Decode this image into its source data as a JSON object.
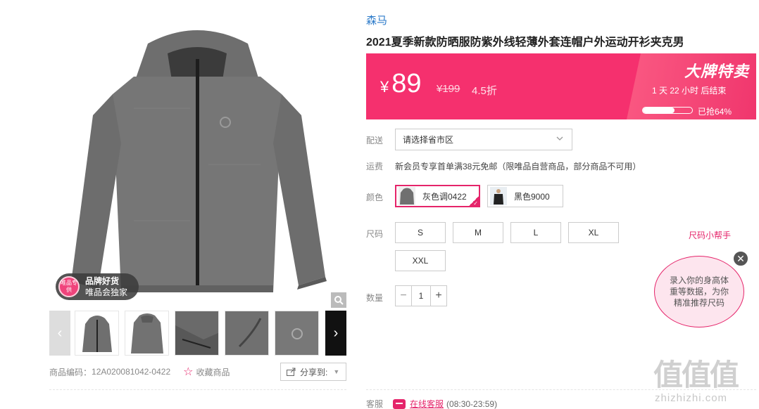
{
  "product": {
    "brand": "森马",
    "title": "2021夏季新款防晒服防紫外线轻薄外套连帽户外运动开衫夹克男"
  },
  "gallery": {
    "badge_icon_text": "唯品专供",
    "badge_line1": "品牌好货",
    "badge_line2": "唯品会独家",
    "prev": "‹",
    "next": "›"
  },
  "price": {
    "currency": "¥",
    "current": "89",
    "original": "¥199",
    "discount": "4.5折",
    "sale_title": "大牌特卖",
    "countdown": "1 天 22 小时 后结束",
    "sold_text": "已抢64%",
    "sold_fraction": 0.64
  },
  "delivery": {
    "label": "配送",
    "placeholder": "请选择省市区"
  },
  "shipping": {
    "label": "运费",
    "text": "新会员专享首单满38元免邮（限唯品自营商品，部分商品不可用）"
  },
  "color": {
    "label": "颜色",
    "options": [
      "灰色调0422",
      "黑色9000"
    ],
    "selected": "灰色调0422"
  },
  "size": {
    "label": "尺码",
    "options": [
      "S",
      "M",
      "L",
      "XL",
      "XXL"
    ]
  },
  "quantity": {
    "label": "数量",
    "value": "1",
    "minus": "−",
    "plus": "+"
  },
  "size_helper": {
    "link": "尺码小帮手",
    "bubble": "录入你的身高体重等数据，为你精准推荐尺码",
    "close": "✕"
  },
  "meta": {
    "sku_label": "商品编码：",
    "sku": "12A020081042-0422",
    "favorite": "收藏商品",
    "share": "分享到:"
  },
  "service": {
    "label": "客服",
    "link": "在线客服",
    "hours": "(08:30-23:59)"
  },
  "watermark": {
    "mark": "值值值",
    "url": "zhizhizhi.com"
  },
  "colors": {
    "accent": "#e5246a",
    "price_bar": "#f5306e",
    "brand_link": "#2b7ac9"
  }
}
